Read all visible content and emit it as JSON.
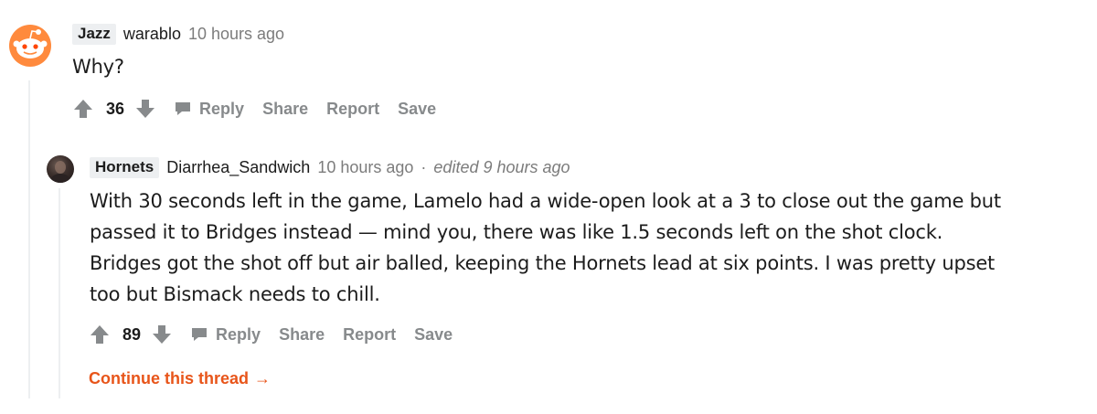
{
  "colors": {
    "vote_gray": "#878a8c",
    "text": "#1c1c1c",
    "meta": "#7c7c7c",
    "flair_bg": "#edeff1",
    "thread_line": "#edeff1",
    "continue_orange": "#e8551a",
    "snoo_orange": "#ff8a3d"
  },
  "comments": [
    {
      "flair": "Jazz",
      "username": "warablo",
      "time": "10 hours ago",
      "edited": "",
      "body": "Why?",
      "votes": "36",
      "actions": {
        "reply": "Reply",
        "share": "Share",
        "report": "Report",
        "save": "Save"
      }
    },
    {
      "flair": "Hornets",
      "username": "Diarrhea_Sandwich",
      "time": "10 hours ago",
      "separator": "·",
      "edited": "edited 9 hours ago",
      "body_lines": [
        "With 30 seconds left in the game, Lamelo had a wide-open look at a 3 to close out the game but",
        "passed it to Bridges instead — mind you, there was like 1.5 seconds left on the shot clock.",
        "Bridges got the shot off but air balled, keeping the Hornets lead at six points. I was pretty upset",
        "too but Bismack needs to chill."
      ],
      "votes": "89",
      "actions": {
        "reply": "Reply",
        "share": "Share",
        "report": "Report",
        "save": "Save"
      }
    }
  ],
  "continue_thread": "Continue this thread",
  "continue_arrow": "→"
}
